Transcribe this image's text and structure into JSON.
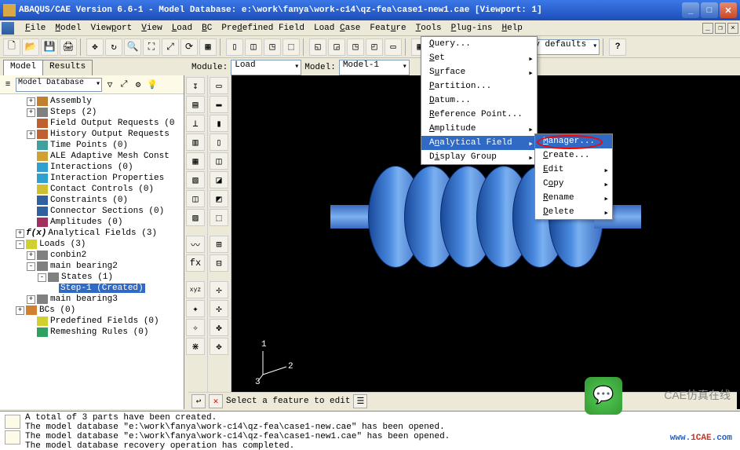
{
  "title": "ABAQUS/CAE Version 6.6-1 - Model Database: e:\\work\\fanya\\work-c14\\qz-fea\\case1-new1.cae [Viewport: 1]",
  "menubar": [
    "File",
    "Model",
    "Viewport",
    "View",
    "Load",
    "BC",
    "Predefined Field",
    "Load Case",
    "Feature",
    "Tools",
    "Plug-ins",
    "Help"
  ],
  "menubar_keys": [
    "F",
    "M",
    "p",
    "V",
    "L",
    "B",
    "d",
    "C",
    "u",
    "T",
    "P",
    "H"
  ],
  "context": {
    "module_label": "Module:",
    "module": "Load",
    "model_label": "Model:",
    "model": "Model-1"
  },
  "toolbar_right_combo": "Assembly defaults",
  "tabs": {
    "model": "Model",
    "results": "Results"
  },
  "tree_combo": "Model Database",
  "tree": [
    {
      "ind": 2,
      "exp": "+",
      "ico": "#c08030",
      "label": "Assembly"
    },
    {
      "ind": 2,
      "exp": "+",
      "ico": "#808080",
      "label": "Steps (2)"
    },
    {
      "ind": 2,
      "exp": "",
      "ico": "#c06030",
      "label": "Field Output Requests (0"
    },
    {
      "ind": 2,
      "exp": "+",
      "ico": "#c06030",
      "label": "History Output Requests"
    },
    {
      "ind": 2,
      "exp": "",
      "ico": "#40a0a0",
      "label": "Time Points (0)"
    },
    {
      "ind": 2,
      "exp": "",
      "ico": "#d0a030",
      "label": "ALE Adaptive Mesh Const"
    },
    {
      "ind": 2,
      "exp": "",
      "ico": "#30a0d0",
      "label": "Interactions (0)"
    },
    {
      "ind": 2,
      "exp": "",
      "ico": "#30a0d0",
      "label": "Interaction Properties"
    },
    {
      "ind": 2,
      "exp": "",
      "ico": "#d0c030",
      "label": "Contact Controls (0)"
    },
    {
      "ind": 2,
      "exp": "",
      "ico": "#3060a0",
      "label": "Constraints (0)"
    },
    {
      "ind": 2,
      "exp": "",
      "ico": "#3060a0",
      "label": "Connector Sections (0)"
    },
    {
      "ind": 2,
      "exp": "",
      "ico": "#a03060",
      "label": "Amplitudes (0)"
    },
    {
      "ind": 1,
      "exp": "+",
      "ico": "#303030",
      "label": "Analytical Fields (3)",
      "prefix": "f(x)"
    },
    {
      "ind": 1,
      "exp": "-",
      "ico": "#d0d030",
      "label": "Loads (3)"
    },
    {
      "ind": 2,
      "exp": "+",
      "ico": "#808080",
      "label": "conbin2"
    },
    {
      "ind": 2,
      "exp": "-",
      "ico": "#808080",
      "label": "main bearing2"
    },
    {
      "ind": 3,
      "exp": "-",
      "ico": "#808080",
      "label": "States (1)"
    },
    {
      "ind": 4,
      "exp": "",
      "ico": "",
      "label": "Step-1 (Created)",
      "sel": true
    },
    {
      "ind": 2,
      "exp": "+",
      "ico": "#808080",
      "label": "main bearing3"
    },
    {
      "ind": 1,
      "exp": "+",
      "ico": "#d08030",
      "label": "BCs (0)"
    },
    {
      "ind": 2,
      "exp": "",
      "ico": "#d0d030",
      "label": "Predefined Fields (0)"
    },
    {
      "ind": 2,
      "exp": "",
      "ico": "#30a060",
      "label": "Remeshing Rules (0)"
    }
  ],
  "tools_menu": [
    {
      "label": "Query...",
      "arr": false,
      "key": "Q"
    },
    {
      "label": "Set",
      "arr": true,
      "key": "S"
    },
    {
      "label": "Surface",
      "arr": true,
      "key": "u"
    },
    {
      "label": "Partition...",
      "key": "P"
    },
    {
      "label": "Datum...",
      "key": "D"
    },
    {
      "label": "Reference Point...",
      "key": "R"
    },
    {
      "label": "Amplitude",
      "arr": true,
      "key": "A"
    },
    {
      "label": "Analytical Field",
      "arr": true,
      "hl": true,
      "key": "n"
    },
    {
      "label": "Display Group",
      "arr": true,
      "key": "i"
    }
  ],
  "submenu": [
    {
      "label": "Manager...",
      "hl": true,
      "key": "M"
    },
    {
      "label": "Create...",
      "key": "C"
    },
    {
      "label": "Edit",
      "arr": true,
      "key": "E"
    },
    {
      "label": "Copy",
      "arr": true,
      "key": "o"
    },
    {
      "label": "Rename",
      "arr": true,
      "key": "R"
    },
    {
      "label": "Delete",
      "arr": true,
      "key": "D"
    }
  ],
  "prompt": "Select a feature to edit",
  "console": [
    "A total of 3 parts have been created.",
    "The model database \"e:\\work\\fanya\\work-c14\\qz-fea\\case1-new.cae\" has been opened.",
    "The model database \"e:\\work\\fanya\\work-c14\\qz-fea\\case1-new1.cae\" has been opened.",
    "The model database recovery operation has completed."
  ],
  "triad_labels": {
    "a": "1",
    "b": "2",
    "c": "3"
  },
  "wm1": "CAE仿真在线",
  "wm2_a": "www.",
  "wm2_b": "1CAE",
  "wm2_c": ".com"
}
